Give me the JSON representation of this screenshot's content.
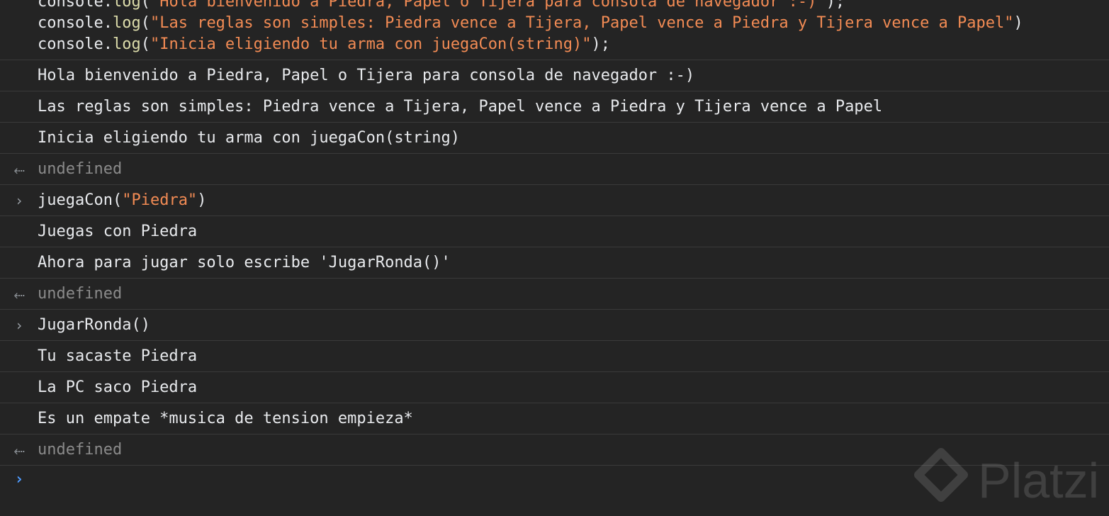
{
  "code": {
    "lines": [
      {
        "prefix": "console.",
        "fn": "log",
        "open": "(",
        "string": "\"Hola bienvenido a Piedra, Papel o Tijera para consola de navegador :-)\"",
        "close": ");"
      },
      {
        "prefix": "console.",
        "fn": "log",
        "open": "(",
        "string": "\"Las reglas son simples: Piedra vence a Tijera, Papel vence a Piedra y Tijera vence a Papel\"",
        "close": ")"
      },
      {
        "prefix": "console.",
        "fn": "log",
        "open": "(",
        "string": "\"Inicia eligiendo tu arma con juegaCon(string)\"",
        "close": ");"
      }
    ]
  },
  "rows": [
    {
      "type": "log",
      "text": "Hola bienvenido a Piedra, Papel o Tijera para consola de navegador :-)"
    },
    {
      "type": "log",
      "text": "Las reglas son simples: Piedra vence a Tijera, Papel vence a Piedra y Tijera vence a Papel"
    },
    {
      "type": "log",
      "text": "Inicia eligiendo tu arma con juegaCon(string)"
    },
    {
      "type": "return",
      "icon": "return-arrow-icon",
      "text": "undefined"
    },
    {
      "type": "input",
      "icon": "input-chevron-icon",
      "fn_text": "juegaCon(",
      "string": "\"Piedra\"",
      "close": ")"
    },
    {
      "type": "log",
      "text": "Juegas con Piedra"
    },
    {
      "type": "log",
      "text": "Ahora para jugar solo escribe 'JugarRonda()'"
    },
    {
      "type": "return",
      "icon": "return-arrow-icon",
      "text": "undefined"
    },
    {
      "type": "input",
      "icon": "input-chevron-icon",
      "fn_text": "JugarRonda()",
      "string": "",
      "close": ""
    },
    {
      "type": "log",
      "text": "Tu sacaste Piedra"
    },
    {
      "type": "log",
      "text": "La PC saco Piedra"
    },
    {
      "type": "log",
      "text": "Es un empate *musica de tension empieza*"
    },
    {
      "type": "return",
      "icon": "return-arrow-icon",
      "text": "undefined"
    }
  ],
  "prompt": {
    "icon": "prompt-chevron-icon",
    "symbol": "›"
  },
  "watermark": {
    "text": "Platzi"
  },
  "colors": {
    "background": "#242424",
    "text": "#e8eaed",
    "string": "#f28b54",
    "function": "#dcdcaa",
    "muted": "#8a8a8a",
    "prompt": "#4e9bff",
    "divider": "#3a3a3a"
  }
}
